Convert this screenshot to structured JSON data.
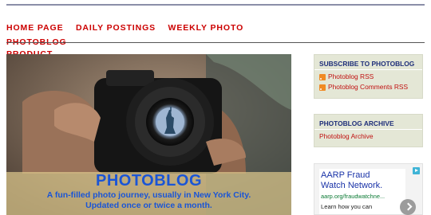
{
  "nav": {
    "items": [
      "HOME PAGE",
      "DAILY POSTINGS",
      "WEEKLY PHOTO",
      "PHOTOBLOG",
      "PRODUCT"
    ]
  },
  "hero": {
    "title": "PHOTOBLOG",
    "subtitle_line1": "A fun-filled photo journey, usually in New York City.",
    "subtitle_line2": "Updated once or twice a month."
  },
  "sidebar": {
    "subscribe": {
      "title": "SUBSCRIBE TO PHOTOBLOG",
      "links": [
        "Photoblog RSS",
        "Photoblog Comments RSS"
      ]
    },
    "archive": {
      "title": "PHOTOBLOG ARCHIVE",
      "link": "Photoblog Archive"
    },
    "ad": {
      "title_line1": "AARP Fraud",
      "title_line2": "Watch Network.",
      "url": "aarp.org/fraudwatchne...",
      "description": "Learn how you can"
    }
  },
  "colors": {
    "nav_red": "#cc0000",
    "headline_blue": "#1a55d6",
    "widget_bg": "#e4e7d6",
    "widget_title": "#1f2f7a"
  },
  "icons": [
    "rss-icon",
    "ad-choices-icon",
    "chevron-right-icon"
  ]
}
